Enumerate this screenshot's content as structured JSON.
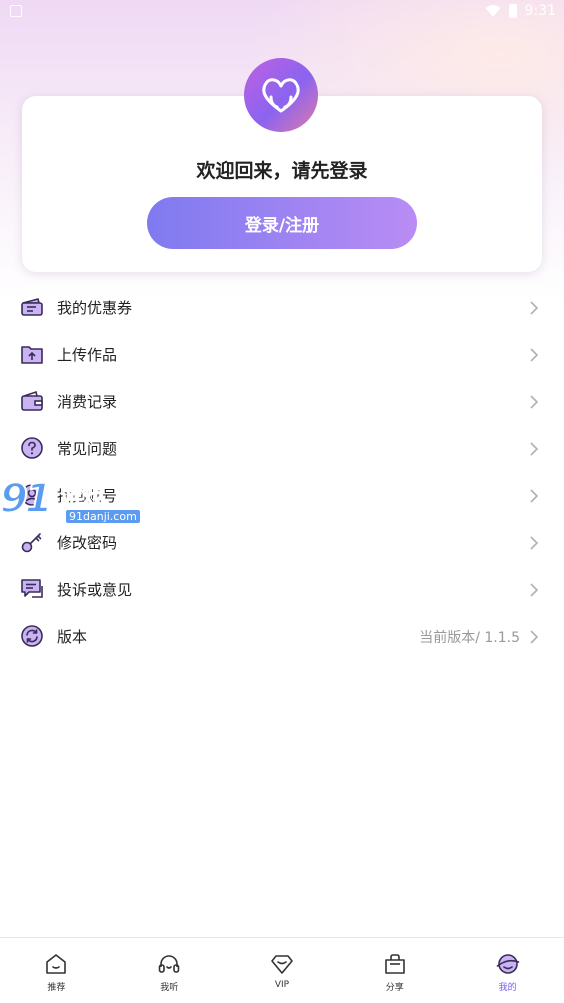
{
  "status_bar": {
    "time": "9:31"
  },
  "header": {
    "welcome_text": "欢迎回来，请先登录",
    "login_button": "登录/注册"
  },
  "menu": [
    {
      "label": "我的优惠券",
      "icon": "coupon-icon",
      "value": ""
    },
    {
      "label": "上传作品",
      "icon": "upload-folder-icon",
      "value": ""
    },
    {
      "label": "消费记录",
      "icon": "wallet-icon",
      "value": ""
    },
    {
      "label": "常见问题",
      "icon": "question-icon",
      "value": ""
    },
    {
      "label": "找回账号",
      "icon": "recover-account-icon",
      "value": ""
    },
    {
      "label": "修改密码",
      "icon": "key-icon",
      "value": ""
    },
    {
      "label": "投诉或意见",
      "icon": "feedback-icon",
      "value": ""
    },
    {
      "label": "版本",
      "icon": "refresh-icon",
      "value": "当前版本/ 1.1.5"
    }
  ],
  "watermark": {
    "brand": "游戏",
    "site": "91danji.com"
  },
  "tabbar": [
    {
      "label": "推荐",
      "icon": "home-icon",
      "active": false
    },
    {
      "label": "我听",
      "icon": "headphones-icon",
      "active": false
    },
    {
      "label": "VIP",
      "icon": "diamond-icon",
      "active": false
    },
    {
      "label": "分享",
      "icon": "share-bag-icon",
      "active": false
    },
    {
      "label": "我的",
      "icon": "profile-planet-icon",
      "active": true
    }
  ],
  "colors": {
    "accent": "#7a5cf0",
    "icon_fill": "#c9b3f3",
    "icon_stroke": "#3a2c5a",
    "button_start": "#7f7af0",
    "button_end": "#b98cf4"
  }
}
